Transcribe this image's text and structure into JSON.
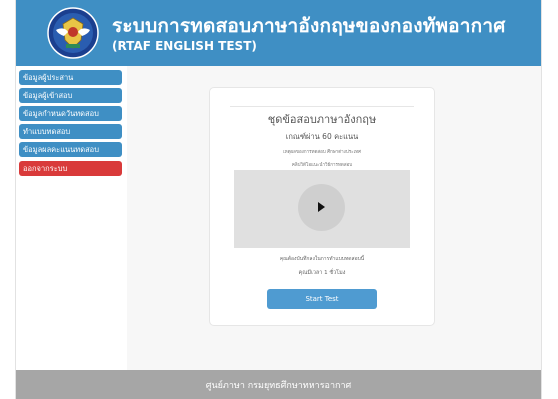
{
  "header": {
    "title_th": "ระบบการทดสอบภาษาอังกฤษของกองทัพอากาศ",
    "title_en": "(RTAF ENGLISH TEST)",
    "logo_icon": "rtaf-emblem-icon",
    "bg_color": "#3f8fc4"
  },
  "sidebar": {
    "items": [
      {
        "label": "ข้อมูลผู้ประสาน",
        "color": "#3f8fc4"
      },
      {
        "label": "ข้อมูลผู้เข้าสอบ",
        "color": "#3f8fc4"
      },
      {
        "label": "ข้อมูลกำหนดวันทดสอบ",
        "color": "#3f8fc4"
      },
      {
        "label": "ทำแบบทดสอบ",
        "color": "#3f8fc4"
      },
      {
        "label": "ข้อมูลผลคะแนนทดสอบ",
        "color": "#3f8fc4"
      },
      {
        "label": "ออกจากระบบ",
        "color": "#d93a3a"
      }
    ]
  },
  "card": {
    "title": "ชุดข้อสอบภาษาอังกฤษ",
    "pass_score": "เกณฑ์ผ่าน 60 คะแนน",
    "info_line1": "เหตุผลของการทดสอบ ศึกษาต่างประเทศ",
    "info_line2": "คลิปวิดีโอแนะนำวิธีการทดสอบ",
    "video_icon": "play-icon",
    "instruction": "คุณต้องบันทึกลงในการทำแบบทดสอบนี้",
    "time_limit": "คุณมีเวลา 1 ชั่วโมง",
    "start_label": "Start Test"
  },
  "footer": {
    "text": "ศูนย์ภาษา กรมยุทธศึกษาทหารอากาศ"
  }
}
